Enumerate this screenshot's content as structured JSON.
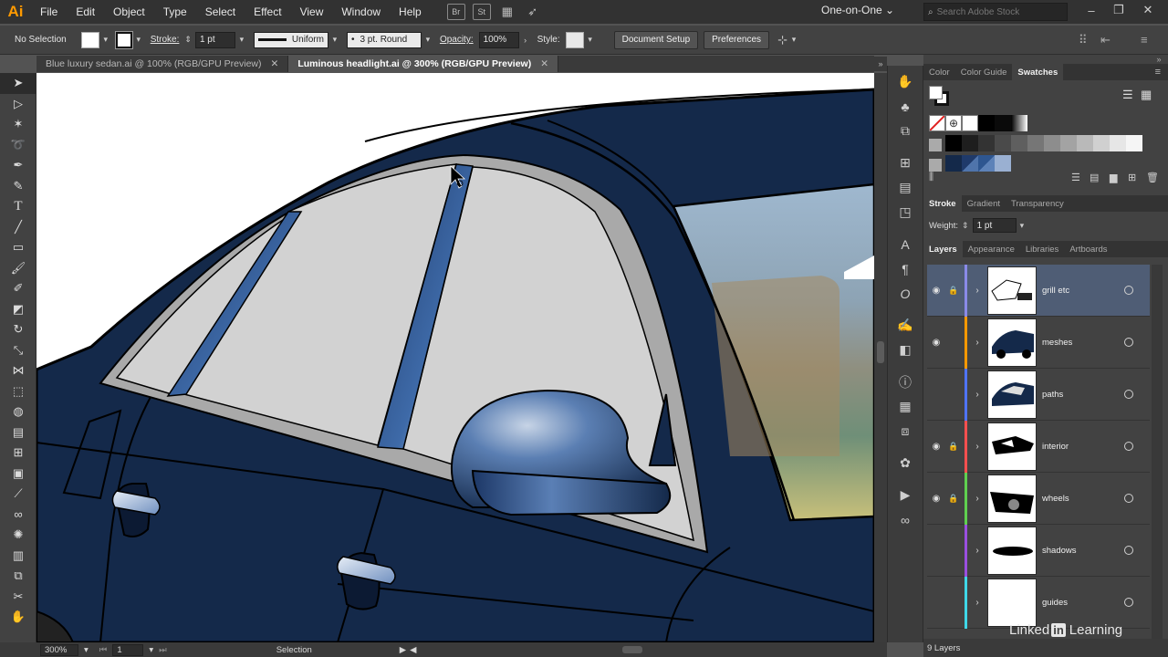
{
  "app": {
    "logo": "Ai"
  },
  "menu": [
    "File",
    "Edit",
    "Object",
    "Type",
    "Select",
    "Effect",
    "View",
    "Window",
    "Help"
  ],
  "menubar_icons": {
    "bridge": "Br",
    "stock": "St",
    "arrange_icon": "arrange-documents-icon",
    "gpu_icon": "gpu-rocket-icon"
  },
  "workspace": {
    "label": "One-on-One",
    "arrow": "⌄"
  },
  "stock_search": {
    "placeholder": "Search Adobe Stock"
  },
  "window_controls": [
    "–",
    "❐",
    "✕"
  ],
  "controlbar": {
    "selection": "No Selection",
    "stroke_label": "Stroke:",
    "stroke_weight": "1 pt",
    "profile": "Uniform",
    "brush": "3 pt. Round",
    "opacity_label": "Opacity:",
    "opacity": "100%",
    "style_label": "Style:",
    "doc_setup": "Document Setup",
    "preferences": "Preferences"
  },
  "tabs": [
    {
      "label": "Blue luxury sedan.ai @ 100% (RGB/GPU Preview)",
      "close": "✕",
      "active": false
    },
    {
      "label": "Luminous headlight.ai @ 300% (RGB/GPU Preview)",
      "close": "✕",
      "active": true
    }
  ],
  "tools": [
    "selection-tool-icon",
    "direct-selection-tool-icon",
    "magic-wand-tool-icon",
    "lasso-tool-icon",
    "pen-tool-icon",
    "curvature-tool-icon",
    "type-tool-icon",
    "line-tool-icon",
    "rectangle-tool-icon",
    "paintbrush-tool-icon",
    "shaper-tool-icon",
    "eraser-tool-icon",
    "rotate-tool-icon",
    "scale-tool-icon",
    "width-tool-icon",
    "free-transform-tool-icon",
    "shape-builder-tool-icon",
    "perspective-grid-tool-icon",
    "mesh-tool-icon",
    "gradient-tool-icon",
    "eyedropper-tool-icon",
    "blend-tool-icon",
    "symbol-sprayer-tool-icon",
    "graph-tool-icon",
    "artboard-tool-icon",
    "slice-tool-icon",
    "hand-tool-icon"
  ],
  "status": {
    "zoom": "300%",
    "artboard": "1",
    "mode": "Selection"
  },
  "panels": {
    "color_tabs": [
      "Color",
      "Color Guide",
      "Swatches"
    ],
    "stroke_tabs": [
      "Stroke",
      "Gradient",
      "Transparency"
    ],
    "weight_label": "Weight:",
    "weight_value": "1 pt",
    "layers_tabs": [
      "Layers",
      "Appearance",
      "Libraries",
      "Artboards"
    ],
    "layers": [
      {
        "name": "grill etc",
        "color": "#8a8ae8",
        "visible": true,
        "locked": true,
        "selected": true
      },
      {
        "name": "meshes",
        "color": "#ff9900",
        "visible": true,
        "locked": false,
        "selected": false
      },
      {
        "name": "paths",
        "color": "#4f74ff",
        "visible": false,
        "locked": false,
        "selected": false
      },
      {
        "name": "interior",
        "color": "#ff4f4f",
        "visible": true,
        "locked": true,
        "selected": false
      },
      {
        "name": "wheels",
        "color": "#5fd04f",
        "visible": true,
        "locked": true,
        "selected": false
      },
      {
        "name": "shadows",
        "color": "#9b4fe0",
        "visible": false,
        "locked": false,
        "selected": false
      },
      {
        "name": "guides",
        "color": "#3fd8e8",
        "visible": false,
        "locked": false,
        "selected": false
      }
    ],
    "layer_count": "9 Layers"
  },
  "colors": {
    "car_body": "#14294a",
    "window_glass": "#d2d2d2",
    "trim": "#a9a9a9",
    "selected_layer": "#4f5d75"
  },
  "watermark": {
    "prefix": "Linked",
    "in": "in",
    "suffix": "Learning"
  }
}
